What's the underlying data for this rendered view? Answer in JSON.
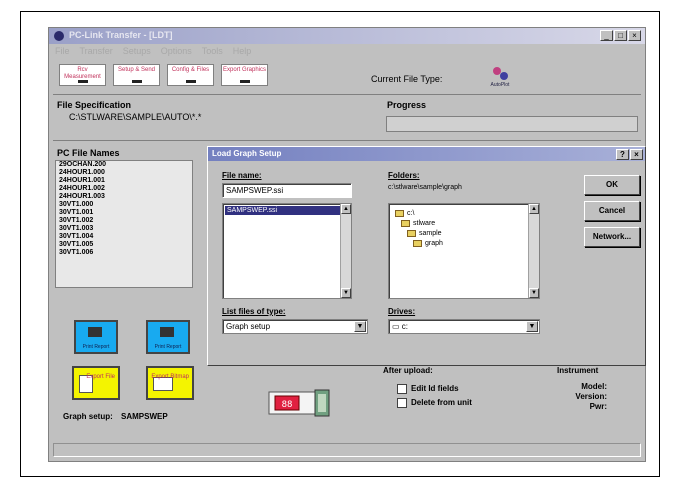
{
  "app": {
    "title": "PC-Link Transfer - [LDT]",
    "menu": [
      "File",
      "Transfer",
      "Setups",
      "Options",
      "Tools",
      "Help"
    ],
    "window_buttons": [
      "_",
      "□",
      "×"
    ]
  },
  "toolbar": {
    "buttons": [
      {
        "label": "Rcv Measurement",
        "icon": "receive-icon"
      },
      {
        "label": "Setup & Send",
        "icon": "setup-icon"
      },
      {
        "label": "Config & Files",
        "icon": "config-icon"
      },
      {
        "label": "Export Graphics",
        "icon": "export-icon"
      }
    ],
    "current_file_type_label": "Current File Type:",
    "current_file_type_icon_label": "AutoPlot"
  },
  "file_spec": {
    "label": "File Specification",
    "value": "C:\\STLWARE\\SAMPLE\\AUTO\\*.*"
  },
  "progress": {
    "label": "Progress"
  },
  "pc_files": {
    "label": "PC File Names",
    "items": [
      "29OCHAN.200",
      "24HOUR1.000",
      "24HOUR1.001",
      "24HOUR1.002",
      "24HOUR1.003",
      "30VT1.000",
      "30VT1.001",
      "30VT1.002",
      "30VT1.003",
      "30VT1.004",
      "30VT1.005",
      "30VT1.006"
    ]
  },
  "action_buttons": {
    "print_report_1": "Print Report",
    "print_report_2": "Print Report",
    "export_file": "Export File",
    "export_bitmap": "Export Bitmap"
  },
  "graph_setup": {
    "label": "Graph setup:",
    "value": "SAMPSWEP"
  },
  "after_upload": {
    "label": "After upload:",
    "options": [
      "Edit Id fields",
      "Delete from unit"
    ]
  },
  "instrument": {
    "label": "Instrument",
    "fields": [
      "Model:",
      "Version:",
      "Pwr:"
    ]
  },
  "dialog": {
    "title": "Load Graph Setup",
    "title_buttons": [
      "?",
      "×"
    ],
    "file_name_label": "File name:",
    "file_name_value": "SAMPSWEP.ssi",
    "file_list": [
      "SAMPSWEP.ssi"
    ],
    "folders_label": "Folders:",
    "folders_path": "c:\\stlware\\sample\\graph",
    "folder_tree": [
      "c:\\",
      "stlware",
      "sample",
      "graph"
    ],
    "list_type_label": "List files of type:",
    "list_type_value": "Graph setup",
    "drives_label": "Drives:",
    "drives_value": "c:",
    "buttons": {
      "ok": "OK",
      "cancel": "Cancel",
      "network": "Network..."
    }
  },
  "colors": {
    "title_gradient_start": "#9aa0c8",
    "dialog_title": "#7480c0",
    "print_button": "#18aaf0",
    "export_button": "#f4f400",
    "selection": "#303080"
  }
}
